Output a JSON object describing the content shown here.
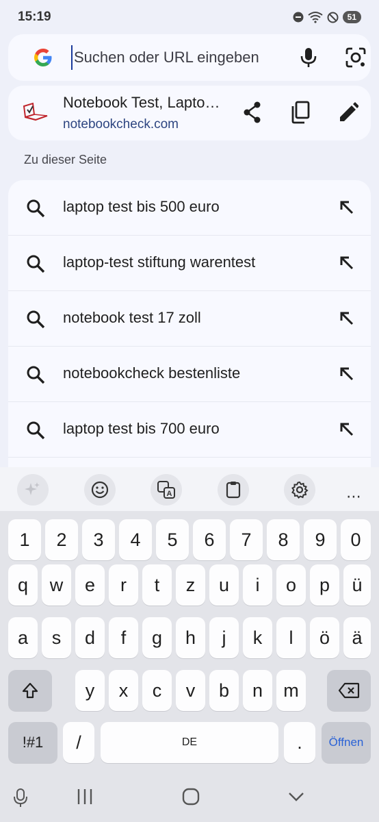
{
  "status": {
    "time": "15:19",
    "battery": "51"
  },
  "search": {
    "placeholder": "Suchen oder URL eingeben",
    "value": ""
  },
  "current_page": {
    "title": "Notebook Test, Lapto…",
    "url": "notebookcheck.com"
  },
  "section_label": "Zu dieser Seite",
  "suggestions": [
    "laptop test bis 500 euro",
    "laptop-test stiftung warentest",
    "notebook test 17 zoll",
    "notebookcheck bestenliste",
    "laptop test bis 700 euro"
  ],
  "keyboard": {
    "numbers": [
      "1",
      "2",
      "3",
      "4",
      "5",
      "6",
      "7",
      "8",
      "9",
      "0"
    ],
    "row1": [
      "q",
      "w",
      "e",
      "r",
      "t",
      "z",
      "u",
      "i",
      "o",
      "p",
      "ü"
    ],
    "row2": [
      "a",
      "s",
      "d",
      "f",
      "g",
      "h",
      "j",
      "k",
      "l",
      "ö",
      "ä"
    ],
    "row3": [
      "y",
      "x",
      "c",
      "v",
      "b",
      "n",
      "m"
    ],
    "symbols": "!#1",
    "slash": "/",
    "space": "DE",
    "period": ".",
    "enter": "Öffnen",
    "toolbar_more": "⋯"
  },
  "colors": {
    "accent": "#2a62d6",
    "background": "#eef0f9"
  }
}
